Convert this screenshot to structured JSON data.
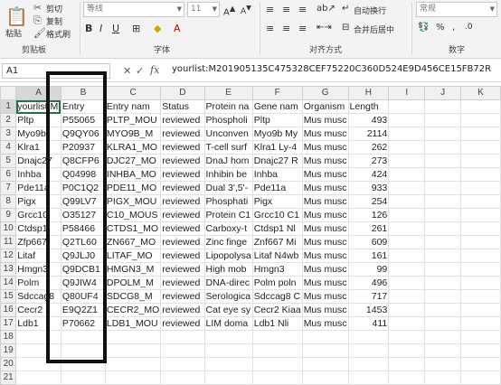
{
  "ribbon": {
    "paste_label": "粘贴",
    "cut_label": "剪切",
    "copy_label": "复制",
    "format_painter_label": "格式刷",
    "clipboard_group": "剪贴板",
    "font_name": "等线",
    "font_size": "11",
    "font_group": "字体",
    "wrap_text_label": "自动换行",
    "merge_center_label": "合并后居中",
    "alignment_group": "对齐方式",
    "number_format": "常规",
    "number_group": "数字"
  },
  "formula_bar": {
    "name_box": "A1",
    "cancel_symbol": "✕",
    "enter_symbol": "✓",
    "fx_label": "fx",
    "content": "yourlist:M201905135C475328CEF75220C360D524E9D456CE15FB72R"
  },
  "columns": [
    "A",
    "B",
    "C",
    "D",
    "E",
    "F",
    "G",
    "H",
    "I",
    "J",
    "K"
  ],
  "rows": [
    {
      "n": "1",
      "a": "yourlist:M",
      "b": "Entry",
      "c": "Entry nam",
      "d": "Status",
      "e": "Protein na",
      "f": "Gene nam",
      "g": "Organism",
      "h": "Length"
    },
    {
      "n": "2",
      "a": "Pltp",
      "b": "P55065",
      "c": "PLTP_MOU",
      "d": "reviewed",
      "e": "Phospholi",
      "f": "Pltp",
      "g": "Mus musc",
      "h": "493"
    },
    {
      "n": "3",
      "a": "Myo9b",
      "b": "Q9QY06",
      "c": "MYO9B_M",
      "d": "reviewed",
      "e": "Unconven",
      "f": "Myo9b My",
      "g": "Mus musc",
      "h": "2114"
    },
    {
      "n": "4",
      "a": "Klra1",
      "b": "P20937",
      "c": "KLRA1_MO",
      "d": "reviewed",
      "e": "T-cell surf",
      "f": "Klra1 Ly-4",
      "g": "Mus musc",
      "h": "262"
    },
    {
      "n": "5",
      "a": "Dnajc27",
      "b": "Q8CFP6",
      "c": "DJC27_MO",
      "d": "reviewed",
      "e": "DnaJ hom",
      "f": "Dnajc27 R",
      "g": "Mus musc",
      "h": "273"
    },
    {
      "n": "6",
      "a": "Inhba",
      "b": "Q04998",
      "c": "INHBA_MO",
      "d": "reviewed",
      "e": "Inhibin be",
      "f": "Inhba",
      "g": "Mus musc",
      "h": "424"
    },
    {
      "n": "7",
      "a": "Pde11a",
      "b": "P0C1Q2",
      "c": "PDE11_MO",
      "d": "reviewed",
      "e": "Dual 3',5'-",
      "f": "Pde11a",
      "g": "Mus musc",
      "h": "933"
    },
    {
      "n": "8",
      "a": "Pigx",
      "b": "Q99LV7",
      "c": "PIGX_MOU",
      "d": "reviewed",
      "e": "Phosphati",
      "f": "Pigx",
      "g": "Mus musc",
      "h": "254"
    },
    {
      "n": "9",
      "a": "Grcc10",
      "b": "O35127",
      "c": "C10_MOUS",
      "d": "reviewed",
      "e": "Protein C1",
      "f": "Grcc10 C1",
      "g": "Mus musc",
      "h": "126"
    },
    {
      "n": "10",
      "a": "Ctdsp1",
      "b": "P58466",
      "c": "CTDS1_MO",
      "d": "reviewed",
      "e": "Carboxy-t",
      "f": "Ctdsp1 Nl",
      "g": "Mus musc",
      "h": "261"
    },
    {
      "n": "11",
      "a": "Zfp667",
      "b": "Q2TL60",
      "c": "ZN667_MO",
      "d": "reviewed",
      "e": "Zinc finge",
      "f": "Znf667 Mi",
      "g": "Mus musc",
      "h": "609"
    },
    {
      "n": "12",
      "a": "Litaf",
      "b": "Q9JLJ0",
      "c": "LITAF_MO",
      "d": "reviewed",
      "e": "Lipopolysa",
      "f": "Litaf N4wb",
      "g": "Mus musc",
      "h": "161"
    },
    {
      "n": "13",
      "a": "Hmgn3",
      "b": "Q9DCB1",
      "c": "HMGN3_M",
      "d": "reviewed",
      "e": "High mob",
      "f": "Hmgn3",
      "g": "Mus musc",
      "h": "99"
    },
    {
      "n": "14",
      "a": "Polm",
      "b": "Q9JIW4",
      "c": "DPOLM_M",
      "d": "reviewed",
      "e": "DNA-direc",
      "f": "Polm poln",
      "g": "Mus musc",
      "h": "496"
    },
    {
      "n": "15",
      "a": "Sdccag8",
      "b": "Q80UF4",
      "c": "SDCG8_M",
      "d": "reviewed",
      "e": "Serologica",
      "f": "Sdccag8 C",
      "g": "Mus musc",
      "h": "717"
    },
    {
      "n": "16",
      "a": "Cecr2",
      "b": "E9Q2Z1",
      "c": "CECR2_MO",
      "d": "reviewed",
      "e": "Cat eye sy",
      "f": "Cecr2 Kiaa",
      "g": "Mus musc",
      "h": "1453"
    },
    {
      "n": "17",
      "a": "Ldb1",
      "b": "P70662",
      "c": "LDB1_MOU",
      "d": "reviewed",
      "e": "LIM doma",
      "f": "Ldb1 Nli",
      "g": "Mus musc",
      "h": "411"
    },
    {
      "n": "18",
      "a": "",
      "b": "",
      "c": "",
      "d": "",
      "e": "",
      "f": "",
      "g": "",
      "h": ""
    },
    {
      "n": "19",
      "a": "",
      "b": "",
      "c": "",
      "d": "",
      "e": "",
      "f": "",
      "g": "",
      "h": ""
    },
    {
      "n": "20",
      "a": "",
      "b": "",
      "c": "",
      "d": "",
      "e": "",
      "f": "",
      "g": "",
      "h": ""
    },
    {
      "n": "21",
      "a": "",
      "b": "",
      "c": "",
      "d": "",
      "e": "",
      "f": "",
      "g": "",
      "h": ""
    }
  ]
}
